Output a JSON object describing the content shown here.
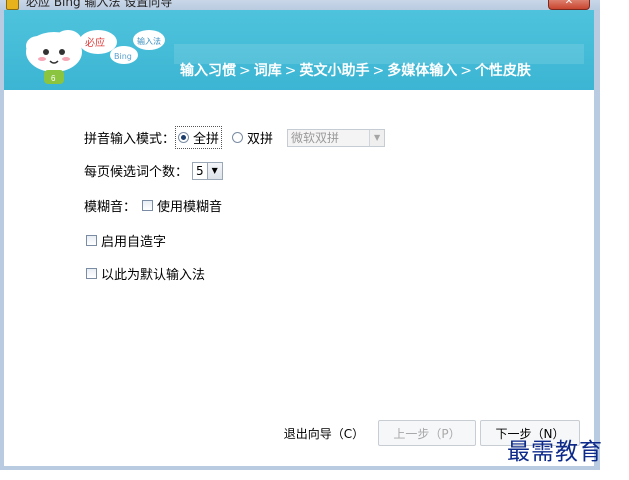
{
  "window": {
    "title": "必应 Bing 输入法 设置向导",
    "close_label": "✕"
  },
  "header": {
    "logo": {
      "tag1": "必应",
      "tag2": "Bing",
      "tag3": "输入法"
    },
    "steps": [
      "输入习惯",
      "词库",
      "英文小助手",
      "多媒体输入",
      "个性皮肤"
    ],
    "separator": ">",
    "active_step": 0
  },
  "form": {
    "pinyin_mode": {
      "label": "拼音输入模式：",
      "options": [
        "全拼",
        "双拼"
      ],
      "selected": "全拼",
      "scheme_value": "微软双拼"
    },
    "candidates": {
      "label": "每页候选词个数：",
      "value": "5"
    },
    "fuzzy": {
      "label": "模糊音：",
      "checkbox_label": "使用模糊音",
      "checked": false
    },
    "self_made_words": {
      "label": "启用自造字",
      "checked": false
    },
    "default_ime": {
      "label": "以此为默认输入法",
      "checked": false
    }
  },
  "footer": {
    "exit_label": "退出向导（C）",
    "prev_label": "上一步（P）",
    "next_label": "下一步（N）"
  },
  "watermark": "最需教育",
  "colors": {
    "header_bg": "#3bb5d3",
    "accent_text": "#ffffff"
  }
}
